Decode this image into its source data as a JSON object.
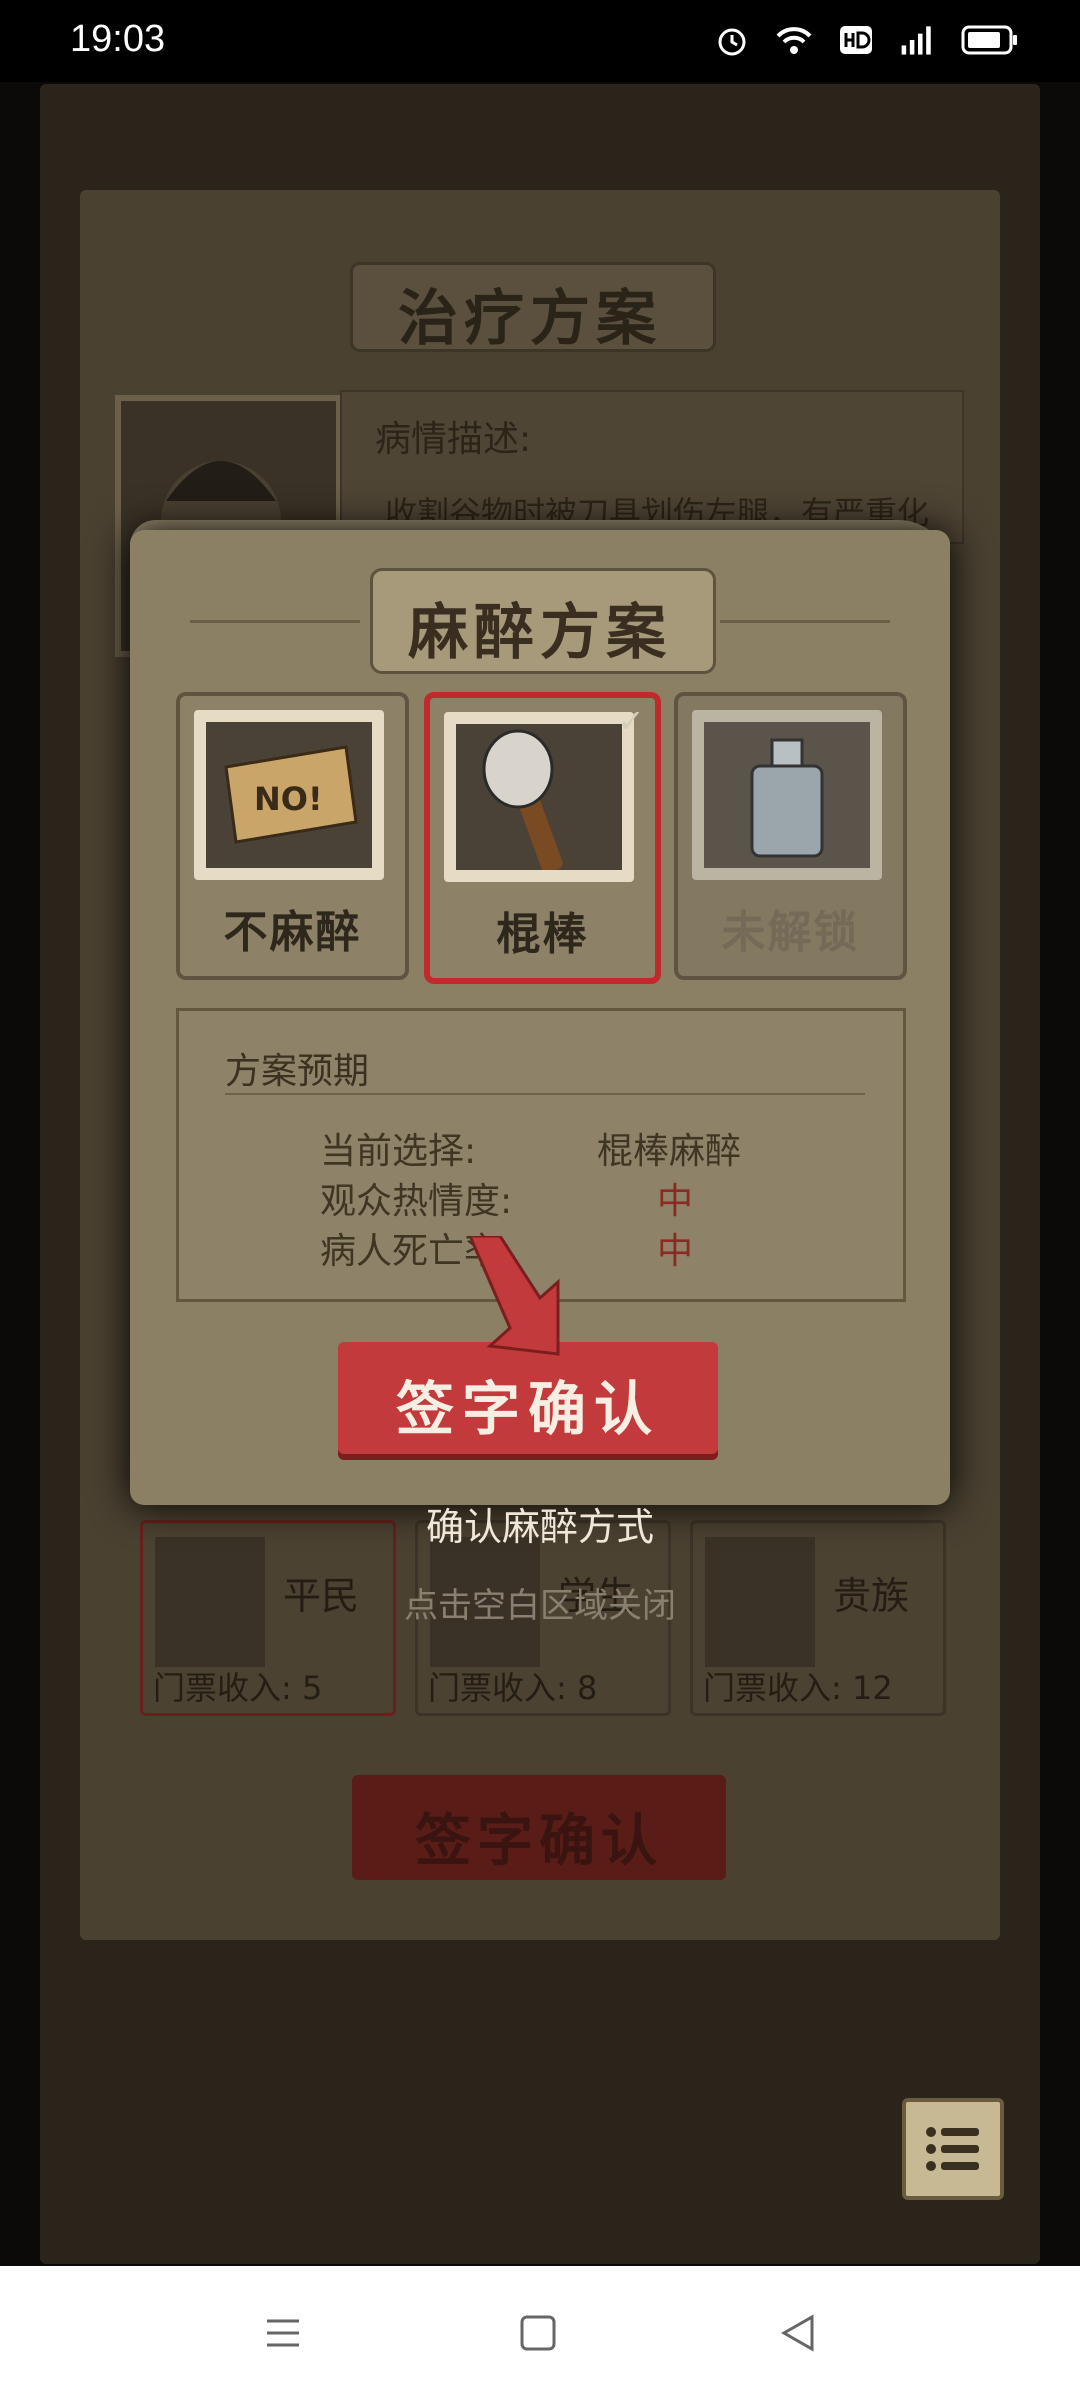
{
  "status": {
    "time": "19:03"
  },
  "background": {
    "title": "治疗方案",
    "desc_label": "病情描述:",
    "desc_text": "收割谷物时被刀具划伤左腿，有严重化",
    "classes": [
      {
        "name": "平民",
        "income": "门票收入: 5"
      },
      {
        "name": "学生",
        "income": "门票收入: 8"
      },
      {
        "name": "贵族",
        "income": "门票收入: 12"
      }
    ],
    "sign_label": "签字确认"
  },
  "modal": {
    "title": "麻醉方案",
    "options": [
      {
        "label": "不麻醉",
        "selected": false,
        "locked": false
      },
      {
        "label": "棍棒",
        "selected": true,
        "locked": false
      },
      {
        "label": "未解锁",
        "selected": false,
        "locked": true
      }
    ],
    "expect": {
      "title": "方案预期",
      "rows": [
        {
          "label": "当前选择:",
          "value": "棍棒麻醉"
        },
        {
          "label": "观众热情度:",
          "value": "中"
        },
        {
          "label": "病人死亡率:",
          "value": "中"
        }
      ]
    },
    "sign_label": "签字确认",
    "hint_main": "确认麻醉方式",
    "hint_close": "点击空白区域关闭",
    "no_sign_text": "NO!"
  }
}
